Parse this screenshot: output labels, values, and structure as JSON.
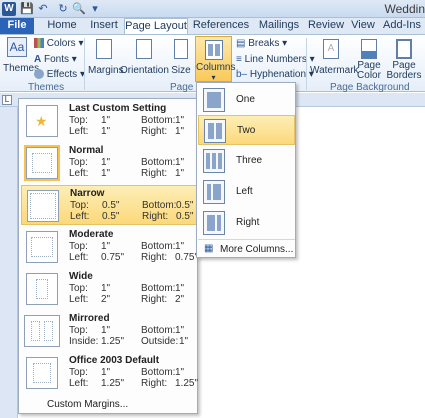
{
  "window": {
    "title": "Weddin"
  },
  "tabs": [
    {
      "label": "File"
    },
    {
      "label": "Home"
    },
    {
      "label": "Insert"
    },
    {
      "label": "Page Layout"
    },
    {
      "label": "References"
    },
    {
      "label": "Mailings"
    },
    {
      "label": "Review"
    },
    {
      "label": "View"
    },
    {
      "label": "Add-Ins"
    }
  ],
  "ribbon": {
    "themes": {
      "themes_label": "Themes",
      "colors": "Colors",
      "fonts": "Fonts",
      "effects": "Effects",
      "group": "Themes"
    },
    "page_setup": {
      "margins": "Margins",
      "orientation": "Orientation",
      "size": "Size",
      "columns": "Columns",
      "breaks": "Breaks",
      "line_numbers": "Line Numbers",
      "hyphenation": "Hyphenation",
      "group": "Page Se"
    },
    "background": {
      "watermark": "Watermark",
      "page_color_1": "Page",
      "page_color_2": "Color",
      "page_borders_1": "Page",
      "page_borders_2": "Borders",
      "group": "Page Background"
    }
  },
  "margins_menu": {
    "items": [
      {
        "name": "Last Custom Setting",
        "top_label": "Top:",
        "top": "1\"",
        "bottom_label": "Bottom:",
        "bottom": "1\"",
        "left_label": "Left:",
        "left": "1\"",
        "right_label": "Right:",
        "right": "1\""
      },
      {
        "name": "Normal",
        "top_label": "Top:",
        "top": "1\"",
        "bottom_label": "Bottom:",
        "bottom": "1\"",
        "left_label": "Left:",
        "left": "1\"",
        "right_label": "Right:",
        "right": "1\""
      },
      {
        "name": "Narrow",
        "top_label": "Top:",
        "top": "0.5\"",
        "bottom_label": "Bottom:",
        "bottom": "0.5\"",
        "left_label": "Left:",
        "left": "0.5\"",
        "right_label": "Right:",
        "right": "0.5\""
      },
      {
        "name": "Moderate",
        "top_label": "Top:",
        "top": "1\"",
        "bottom_label": "Bottom:",
        "bottom": "1\"",
        "left_label": "Left:",
        "left": "0.75\"",
        "right_label": "Right:",
        "right": "0.75\""
      },
      {
        "name": "Wide",
        "top_label": "Top:",
        "top": "1\"",
        "bottom_label": "Bottom:",
        "bottom": "1\"",
        "left_label": "Left:",
        "left": "2\"",
        "right_label": "Right:",
        "right": "2\""
      },
      {
        "name": "Mirrored",
        "top_label": "Top:",
        "top": "1\"",
        "bottom_label": "Bottom:",
        "bottom": "1\"",
        "left_label": "Inside:",
        "left": "1.25\"",
        "right_label": "Outside:",
        "right": "1\""
      },
      {
        "name": "Office 2003 Default",
        "top_label": "Top:",
        "top": "1\"",
        "bottom_label": "Bottom:",
        "bottom": "1\"",
        "left_label": "Left:",
        "left": "1.25\"",
        "right_label": "Right:",
        "right": "1.25\""
      }
    ],
    "custom": "Custom Margins..."
  },
  "columns_menu": {
    "items": [
      {
        "label": "One"
      },
      {
        "label": "Two"
      },
      {
        "label": "Three"
      },
      {
        "label": "Left"
      },
      {
        "label": "Right"
      }
    ],
    "more": "More Columns..."
  },
  "colors": {
    "accent": "#2a63b8",
    "highlight": "#fbd97a"
  }
}
